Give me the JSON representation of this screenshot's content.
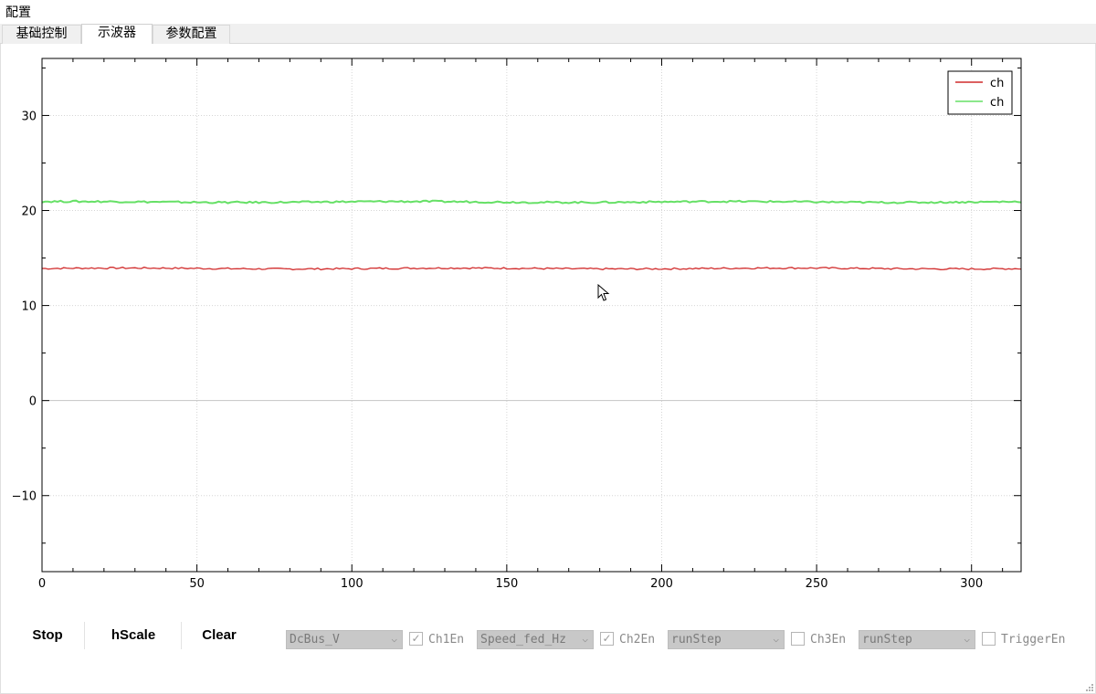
{
  "window": {
    "title": "配置"
  },
  "tabs": [
    {
      "label": "基础控制",
      "active": false
    },
    {
      "label": "示波器",
      "active": true
    },
    {
      "label": "参数配置",
      "active": false
    }
  ],
  "chart_data": {
    "type": "line",
    "xlim": [
      0,
      316
    ],
    "ylim": [
      -18,
      36
    ],
    "x_ticks": [
      0,
      50,
      100,
      150,
      200,
      250,
      300
    ],
    "y_ticks": [
      -10,
      0,
      10,
      20,
      30
    ],
    "grid": true,
    "legend_position": "top-right",
    "series": [
      {
        "name": "ch",
        "color": "#d12b2b",
        "x_range": [
          0,
          316
        ],
        "values_approx": 13.9
      },
      {
        "name": "ch",
        "color": "#66e066",
        "x_range": [
          0,
          316
        ],
        "values_approx": 20.9
      }
    ]
  },
  "controls": {
    "stop_label": "Stop",
    "hscale_label": "hScale",
    "clear_label": "Clear",
    "ch1": {
      "select_value": "DcBus_V",
      "enable_label": "Ch1En",
      "checked": true
    },
    "ch2": {
      "select_value": "Speed_fed_Hz",
      "enable_label": "Ch2En",
      "checked": true
    },
    "ch3": {
      "select_value": "runStep",
      "enable_label": "Ch3En",
      "checked": false
    },
    "trigger": {
      "select_value": "runStep",
      "enable_label": "TriggerEn",
      "checked": false
    }
  },
  "icons": {
    "dropdown": "chevron-down-icon",
    "check": "check-icon",
    "cursor": "mouse-pointer-icon",
    "grip": "resize-grip-icon"
  }
}
